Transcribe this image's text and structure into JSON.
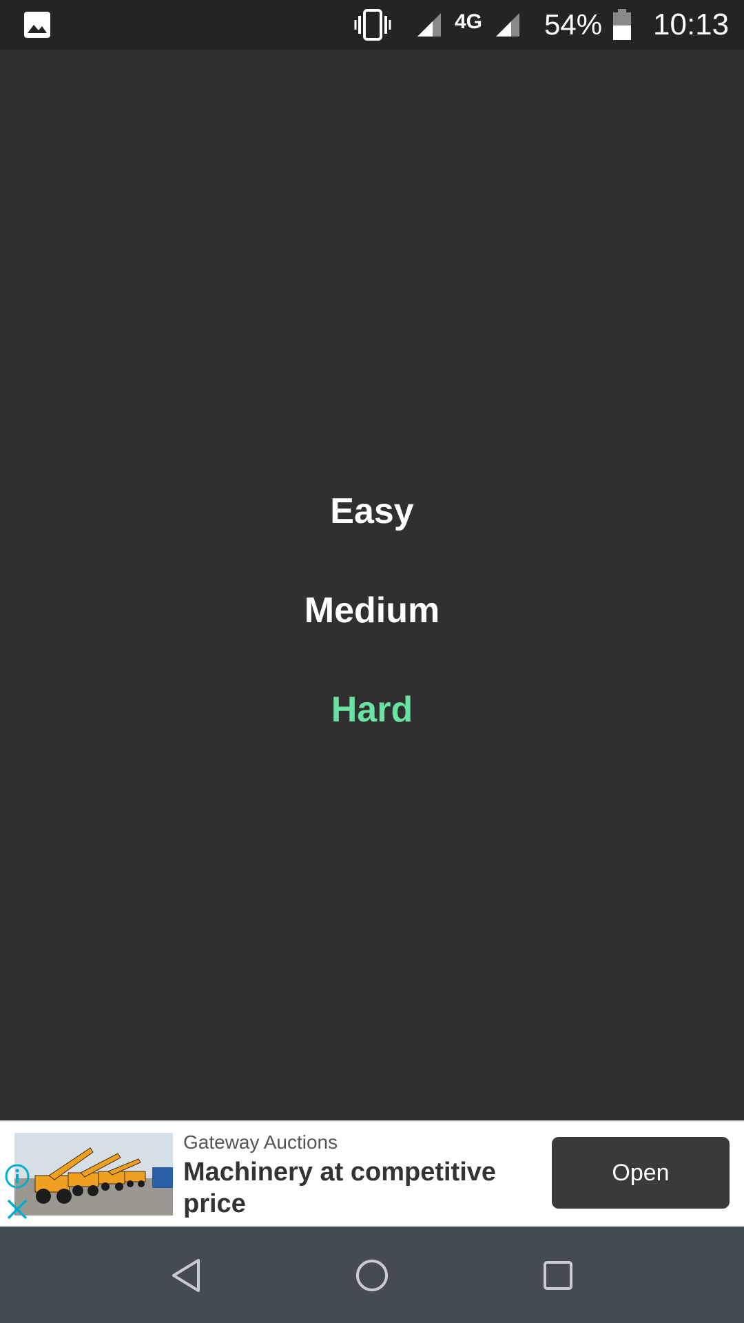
{
  "status_bar": {
    "battery_percent": "54%",
    "network": "4G",
    "time": "10:13",
    "icons": [
      "gallery-icon",
      "vibrate-icon",
      "signal-icon",
      "signal-icon",
      "battery-icon"
    ]
  },
  "menu": {
    "items": [
      {
        "label": "Easy",
        "color": "#ffffff"
      },
      {
        "label": "Medium",
        "color": "#ffffff"
      },
      {
        "label": "Hard",
        "color": "#69e2a3"
      }
    ]
  },
  "ad": {
    "advertiser": "Gateway Auctions",
    "headline": "Machinery at competitive price",
    "button_label": "Open",
    "icons": [
      "info-icon",
      "close-icon"
    ],
    "accent_color": "#00aecd"
  },
  "nav_bar": {
    "icons": [
      "back-icon",
      "home-icon",
      "recents-icon"
    ]
  }
}
